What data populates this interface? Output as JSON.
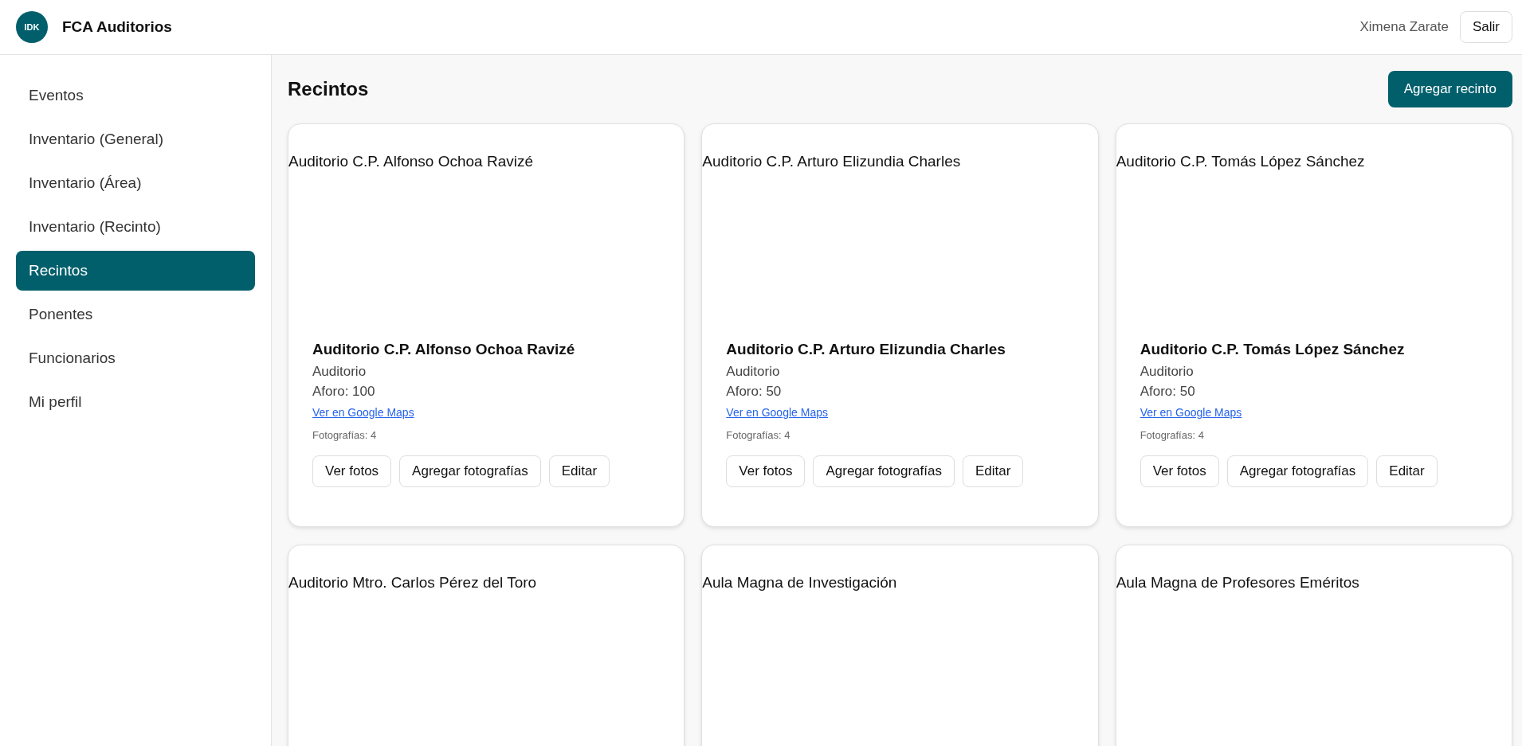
{
  "header": {
    "logo_text": "IDK",
    "app_name": "FCA Auditorios",
    "user_name": "Ximena Zarate",
    "logout_button": "Salir"
  },
  "sidebar": {
    "items": [
      {
        "label": "Eventos",
        "selected": false
      },
      {
        "label": "Inventario (General)",
        "selected": false
      },
      {
        "label": "Inventario (Área)",
        "selected": false
      },
      {
        "label": "Inventario (Recinto)",
        "selected": false
      },
      {
        "label": "Recintos",
        "selected": true
      },
      {
        "label": "Ponentes",
        "selected": false
      },
      {
        "label": "Funcionarios",
        "selected": false
      },
      {
        "label": "Mi perfil",
        "selected": false
      }
    ]
  },
  "page": {
    "title": "Recintos",
    "add_button": "Agregar recinto"
  },
  "cards": [
    {
      "image_alt": "Auditorio C.P. Alfonso Ochoa Ravizé",
      "name": "Auditorio C.P. Alfonso Ochoa Ravizé",
      "type": "Auditorio",
      "capacity": "Aforo: 100",
      "map_link": "Ver en Google Maps",
      "photos": "Fotografías: 4",
      "buttons": [
        "Ver fotos",
        "Agregar fotografías",
        "Editar"
      ]
    },
    {
      "image_alt": "Auditorio C.P. Arturo Elizundia Charles",
      "name": "Auditorio C.P. Arturo Elizundia Charles",
      "type": "Auditorio",
      "capacity": "Aforo: 50",
      "map_link": "Ver en Google Maps",
      "photos": "Fotografías: 4",
      "buttons": [
        "Ver fotos",
        "Agregar fotografías",
        "Editar"
      ]
    },
    {
      "image_alt": "Auditorio C.P. Tomás López Sánchez",
      "name": "Auditorio C.P. Tomás López Sánchez",
      "type": "Auditorio",
      "capacity": "Aforo: 50",
      "map_link": "Ver en Google Maps",
      "photos": "Fotografías: 4",
      "buttons": [
        "Ver fotos",
        "Agregar fotografías",
        "Editar"
      ]
    },
    {
      "image_alt": "Auditorio Mtro. Carlos Pérez del Toro"
    },
    {
      "image_alt": "Aula Magna de Investigación"
    },
    {
      "image_alt": "Aula Magna de Profesores Eméritos"
    }
  ]
}
